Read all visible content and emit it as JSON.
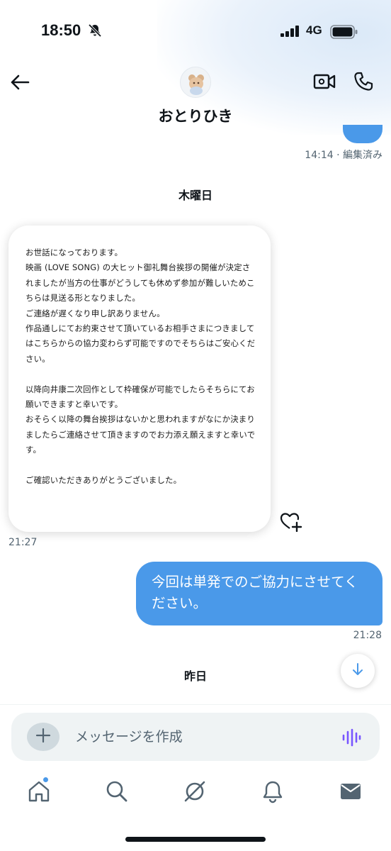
{
  "status_bar": {
    "time": "18:50",
    "network": "4G"
  },
  "header": {
    "contact_name": "おとりひき"
  },
  "messages": {
    "prev_timestamp": "14:14 · 編集済み",
    "day_thursday": "木曜日",
    "image_text": "お世話になっております。\n映画 (LOVE SONG) の大ヒット御礼舞台挨拶の開催が決定されましたが当方の仕事がどうしても休めず参加が難しいためこちらは見送る形となりました。\nご連絡が遅くなり申し訳ありません。\n作品通しにてお約束させて頂いているお相手さまにつきましてはこちらからの協力変わらず可能ですのでそちらはご安心ください。\n\n以降向井康二次回作として枠確保が可能でしたらそちらにてお願いできますと幸いです。\nおそらく以降の舞台挨拶はないかと思われますがなにか決まりましたらご連絡させて頂きますのでお力添え願えますと幸いです。\n\nご確認いただきありがとうございました。",
    "image_timestamp": "21:27",
    "outgoing_text": "今回は単発でのご協力にさせてください。",
    "outgoing_timestamp": "21:28",
    "day_yesterday": "昨日"
  },
  "composer": {
    "placeholder": "メッセージを作成"
  },
  "nav": {
    "items": [
      "home-icon",
      "search-icon",
      "grok-icon",
      "notifications-icon",
      "messages-icon"
    ]
  },
  "colors": {
    "accent": "#4a99e9",
    "text": "#0f1419",
    "muted": "#536471",
    "composer_bg": "#eff3f4",
    "voice": "#7856ff"
  }
}
